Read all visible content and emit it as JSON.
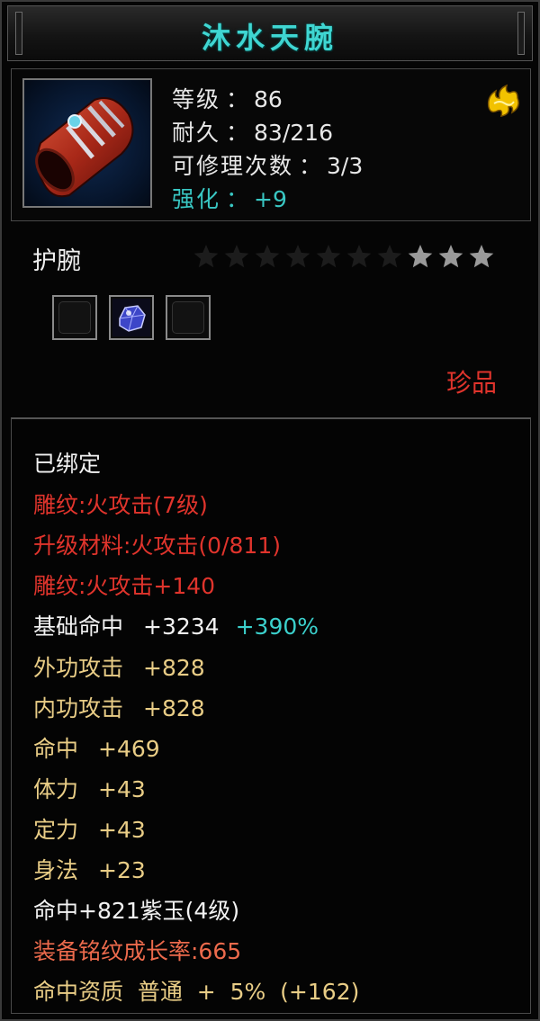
{
  "title": "沐水天腕",
  "item": {
    "icon": "bracer-item-icon",
    "badge_icon": "gold-emblem-icon",
    "level_label": "等级",
    "level_value": "86",
    "durability_label": "耐久",
    "durability_value": "83/216",
    "repair_label": "可修理次数",
    "repair_value": "3/3",
    "enhance_label": "强化",
    "enhance_value": "+9",
    "separator": "："
  },
  "type": "护腕",
  "star_rating": {
    "filled": 3,
    "total": 10
  },
  "gem_slots": [
    {
      "state": "empty",
      "icon": "empty-slot-icon"
    },
    {
      "state": "gem",
      "icon": "purple-jade-gem-icon"
    },
    {
      "state": "empty",
      "icon": "empty-slot-icon"
    }
  ],
  "quality": "珍品",
  "attributes": {
    "bound": "已绑定",
    "engrave_1": "雕纹:火攻击(7级)",
    "upgrade_material": "升级材料:火攻击(0/811)",
    "engrave_2": "雕纹:火攻击+140",
    "base_hit_label": "基础命中",
    "base_hit_value": "+3234",
    "base_hit_bonus": "+390%",
    "ext_atk_label": "外功攻击",
    "ext_atk_value": "+828",
    "int_atk_label": "内功攻击",
    "int_atk_value": "+828",
    "hit_label": "命中",
    "hit_value": "+469",
    "stamina_label": "体力",
    "stamina_value": "+43",
    "focus_label": "定力",
    "focus_value": "+43",
    "agility_label": "身法",
    "agility_value": "+23",
    "gem_line": "命中+821紫玉(4级)",
    "growth_rate": "装备铭纹成长率:665",
    "aptitude": "命中资质  普通  +  5%  (+162)"
  },
  "colors": {
    "title": "#3fd6d2",
    "red": "#e0342c",
    "tan": "#e9cd86",
    "cyan": "#3bd0cc",
    "salmon": "#ec6a4c"
  }
}
